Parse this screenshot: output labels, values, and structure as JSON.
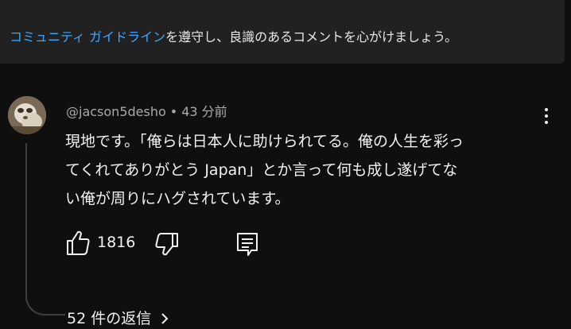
{
  "guidelines": {
    "link_text": "コミュニティ ガイドライン",
    "rest_text": "を遵守し、良識のあるコメントを心がけましょう。"
  },
  "comment": {
    "author": "@jacson5desho",
    "separator": "•",
    "timestamp": "43 分前",
    "lines": [
      "現地です。「俺らは日本人に助けられてる。俺の人生を彩っ",
      "てくれてありがとう Japan」とか言って何も成し遂げてな",
      "い俺が周りにハグされています。"
    ],
    "like_count": "1816"
  },
  "replies": {
    "label": "52 件の返信"
  },
  "colors": {
    "background": "#0f0f0f",
    "panel": "#212121",
    "link": "#3ea6ff",
    "secondary_text": "#aaaaaa"
  }
}
